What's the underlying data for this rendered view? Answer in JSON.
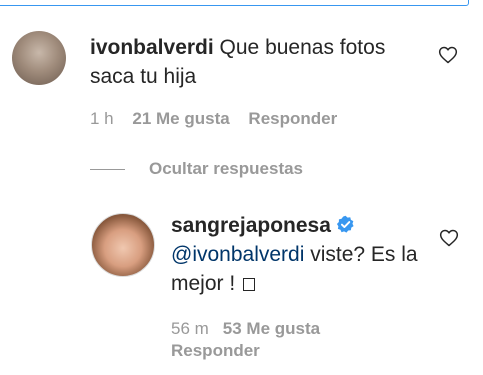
{
  "comment_1": {
    "username": "ivonbalverdi",
    "text": " Que buenas fotos saca tu hija",
    "time": "1 h",
    "likes": "21 Me gusta",
    "reply_label": "Responder"
  },
  "replies_toggle": {
    "label": "Ocultar respuestas"
  },
  "comment_2": {
    "username": "sangrejaponesa",
    "verified": true,
    "mention": "@ivonbalverdi",
    "text": " viste? Es la mejor ! ",
    "time": "56 m",
    "likes": "53 Me gusta",
    "reply_label": "Responder"
  },
  "colors": {
    "link": "#003569",
    "verified_badge": "#3897f0",
    "meta_gray": "#999999",
    "text": "#262626"
  },
  "icons": [
    "heart-icon",
    "verified-badge-icon",
    "emoji-box-icon"
  ]
}
